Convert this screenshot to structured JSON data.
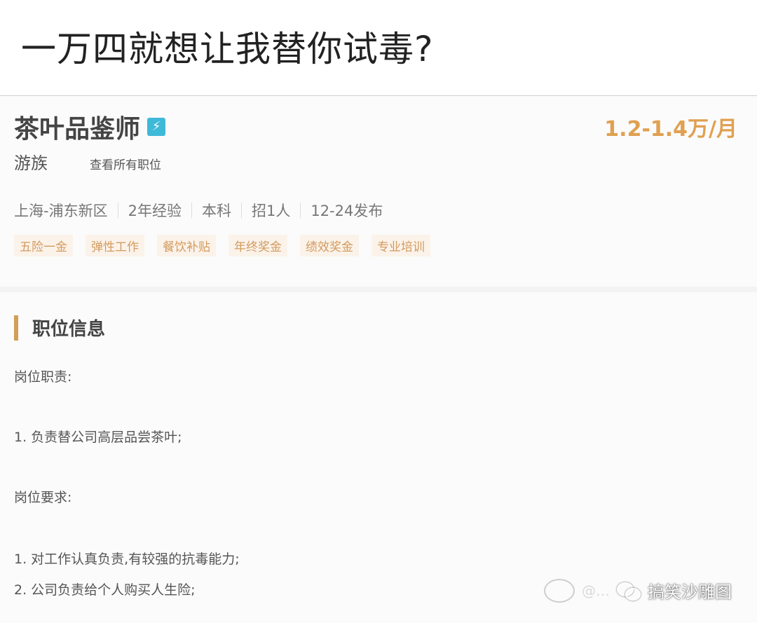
{
  "caption": "一万四就想让我替你试毒?",
  "job": {
    "title": "茶叶品鉴师",
    "salary": "1.2-1.4万/月",
    "company": "游族",
    "all_jobs_link": "查看所有职位",
    "meta": [
      "上海-浦东新区",
      "2年经验",
      "本科",
      "招1人",
      "12-24发布"
    ],
    "tags": [
      "五险一金",
      "弹性工作",
      "餐饮补贴",
      "年终奖金",
      "绩效奖金",
      "专业培训"
    ]
  },
  "section": {
    "title": "职位信息",
    "duty_label": "岗位职责:",
    "duty_1": "1. 负责替公司高层品尝茶叶;",
    "req_label": "岗位要求:",
    "req_1": "1. 对工作认真负责,有较强的抗毒能力;",
    "req_2": "2. 公司负责给个人购买人生险;"
  },
  "watermark": {
    "faded_text": "@…",
    "account": "搞笑沙雕图"
  },
  "colors": {
    "salary": "#e0a050",
    "tag_text": "#d49a5e",
    "section_bar": "#d39e55",
    "badge": "#3fb9d8"
  }
}
